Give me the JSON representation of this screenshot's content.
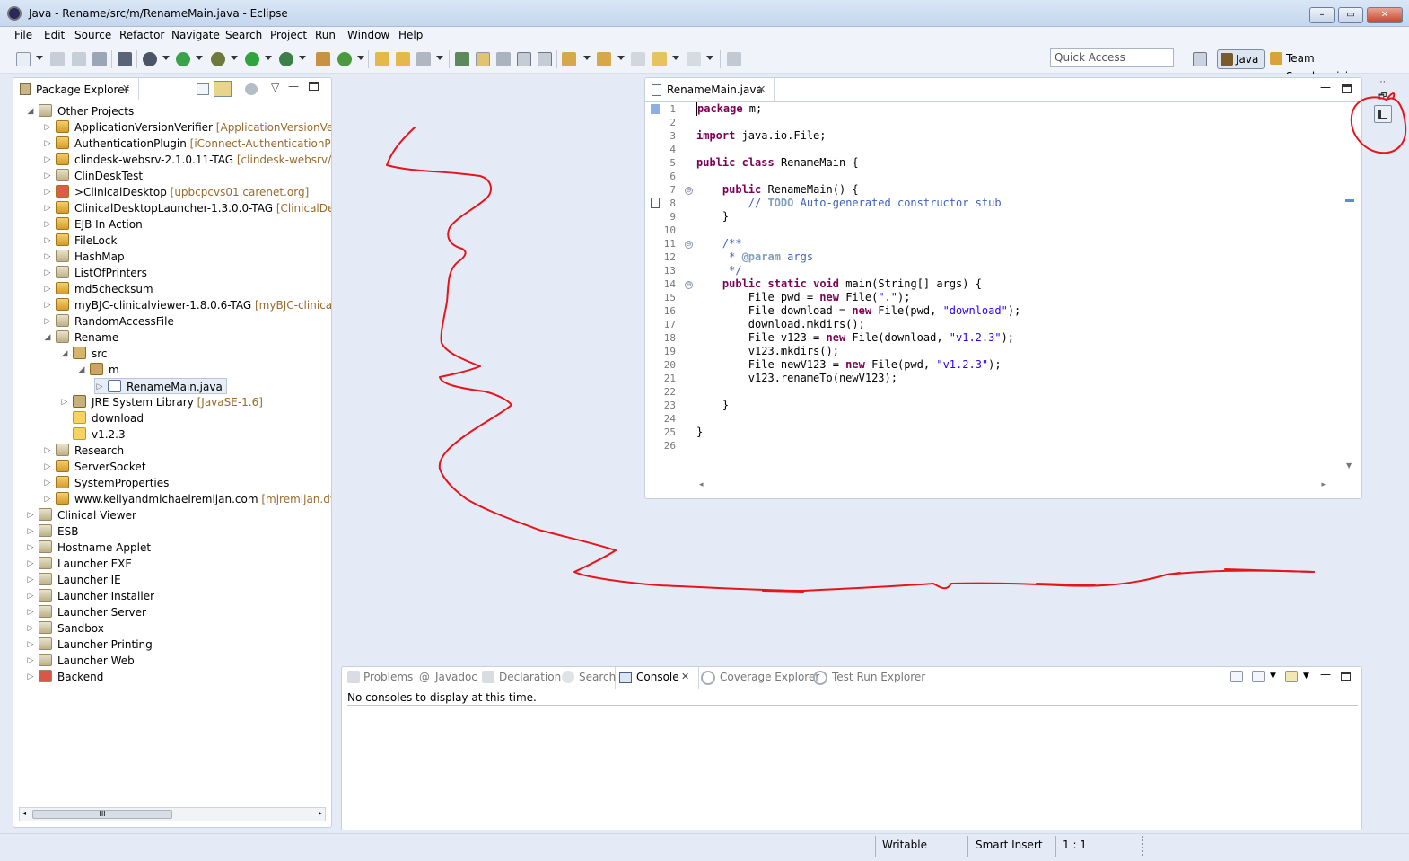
{
  "window": {
    "title": "Java - Rename/src/m/RenameMain.java - Eclipse",
    "minimize": "–",
    "maximize": "▭",
    "close": "✕"
  },
  "menu": [
    "File",
    "Edit",
    "Source",
    "Refactor",
    "Navigate",
    "Search",
    "Project",
    "Run",
    "Window",
    "Help"
  ],
  "toolbar": {
    "quick_access_placeholder": "Quick Access"
  },
  "perspectives": {
    "java": "Java",
    "team": "Team Synchronizing"
  },
  "package_explorer": {
    "tab_label": "Package Explorer",
    "scroll_thumb": "III",
    "items": [
      {
        "label": "Other Projects",
        "dec": ""
      },
      {
        "label": "ApplicationVersionVerifier",
        "dec": " [ApplicationVersionVerifier"
      },
      {
        "label": "AuthenticationPlugin",
        "dec": " [iConnect-AuthenticationPlugi"
      },
      {
        "label": "clindesk-websrv-2.1.0.11-TAG",
        "dec": " [clindesk-websrv/tags/"
      },
      {
        "label": "ClinDeskTest",
        "dec": ""
      },
      {
        "label": ">ClinicalDesktop",
        "dec": "   [upbcpcvs01.carenet.org]"
      },
      {
        "label": "ClinicalDesktopLauncher-1.3.0.0-TAG",
        "dec": " [ClinicalDeskto"
      },
      {
        "label": "EJB In Action",
        "dec": ""
      },
      {
        "label": "FileLock",
        "dec": ""
      },
      {
        "label": "HashMap",
        "dec": ""
      },
      {
        "label": "ListOfPrinters",
        "dec": ""
      },
      {
        "label": "md5checksum",
        "dec": ""
      },
      {
        "label": "myBJC-clinicalviewer-1.8.0.6-TAG",
        "dec": " [myBJC-clinicalvie"
      },
      {
        "label": "RandomAccessFile",
        "dec": ""
      },
      {
        "label": "Rename",
        "dec": ""
      },
      {
        "label": "src",
        "dec": ""
      },
      {
        "label": "m",
        "dec": ""
      },
      {
        "label": "RenameMain.java",
        "dec": ""
      },
      {
        "label": "JRE System Library",
        "dec": " [JavaSE-1.6]"
      },
      {
        "label": "download",
        "dec": ""
      },
      {
        "label": "v1.2.3",
        "dec": ""
      },
      {
        "label": "Research",
        "dec": ""
      },
      {
        "label": "ServerSocket",
        "dec": ""
      },
      {
        "label": "SystemProperties",
        "dec": ""
      },
      {
        "label": "www.kellyandmichaelremijan.com",
        "dec": "   [mjremijan.dynd"
      },
      {
        "label": "Clinical Viewer",
        "dec": ""
      },
      {
        "label": "ESB",
        "dec": ""
      },
      {
        "label": "Hostname Applet",
        "dec": ""
      },
      {
        "label": "Launcher EXE",
        "dec": ""
      },
      {
        "label": "Launcher IE",
        "dec": ""
      },
      {
        "label": "Launcher Installer",
        "dec": ""
      },
      {
        "label": "Launcher Server",
        "dec": ""
      },
      {
        "label": "Sandbox",
        "dec": ""
      },
      {
        "label": "Launcher Printing",
        "dec": ""
      },
      {
        "label": "Launcher Web",
        "dec": ""
      },
      {
        "label": "Backend",
        "dec": ""
      }
    ]
  },
  "editor": {
    "tab_label": "RenameMain.java",
    "line_numbers": [
      "1",
      "2",
      "3",
      "4",
      "5",
      "6",
      "7",
      "8",
      "9",
      "10",
      "11",
      "12",
      "13",
      "14",
      "15",
      "16",
      "17",
      "18",
      "19",
      "20",
      "21",
      "22",
      "23",
      "24",
      "25",
      "26"
    ]
  },
  "console": {
    "tabs": [
      "Problems",
      "Javadoc",
      "Declaration",
      "Search",
      "Console",
      "Coverage Explorer",
      "Test Run Explorer"
    ],
    "active_tab": "Console",
    "message": "No consoles to display at this time."
  },
  "status": {
    "writable": "Writable",
    "insert_mode": "Smart Insert",
    "position": "1 : 1"
  },
  "colors": {
    "annotation_ink": "#e8141b",
    "keyword": "#7f0055",
    "comment": "#3f5fbf",
    "string": "#2a00ff"
  }
}
